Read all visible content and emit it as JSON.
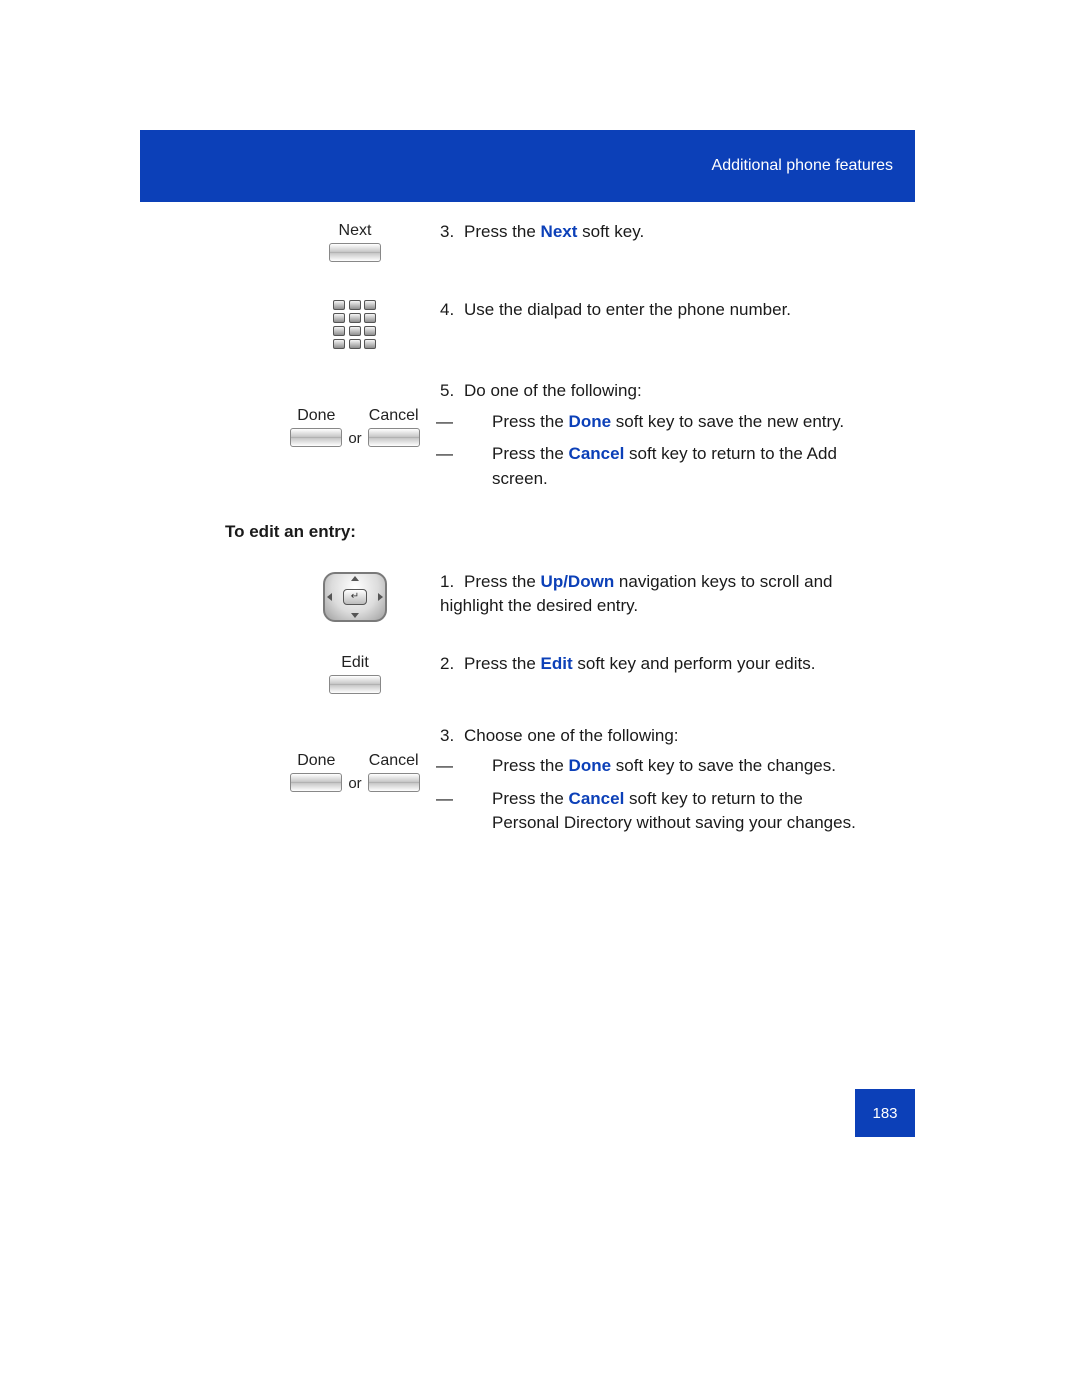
{
  "header": {
    "title": "Additional phone features"
  },
  "buttons": {
    "next": "Next",
    "done": "Done",
    "cancel": "Cancel",
    "or": "or",
    "edit": "Edit"
  },
  "steps": {
    "s3_num": "3.",
    "s3_a": "Press the ",
    "s3_key": "Next",
    "s3_b": " soft key.",
    "s4_num": "4.",
    "s4_text": "Use the dialpad to enter the phone number.",
    "s5_num": "5.",
    "s5_text": "Do one of the following:",
    "s5_sub1_a": "Press the ",
    "s5_sub1_key": "Done",
    "s5_sub1_b": " soft key to save the new entry.",
    "s5_sub2_a": "Press the ",
    "s5_sub2_key": "Cancel",
    "s5_sub2_b": " soft key to return to the Add screen."
  },
  "heading_edit": "To edit an entry:",
  "edit_steps": {
    "e1_num": "1.",
    "e1_a": "Press the ",
    "e1_key": "Up/Down",
    "e1_b": " navigation keys to scroll and highlight the desired entry.",
    "e2_num": "2.",
    "e2_a": "Press the ",
    "e2_key": "Edit",
    "e2_b": " soft key and perform your edits.",
    "e3_num": "3.",
    "e3_text": "Choose one of the following:",
    "e3_sub1_a": "Press the ",
    "e3_sub1_key": "Done",
    "e3_sub1_b": " soft key to save the changes.",
    "e3_sub2_a": "Press the ",
    "e3_sub2_key": "Cancel",
    "e3_sub2_b": " soft key to return to the Personal Directory without saving your changes."
  },
  "page_number": "183",
  "dash": "—"
}
